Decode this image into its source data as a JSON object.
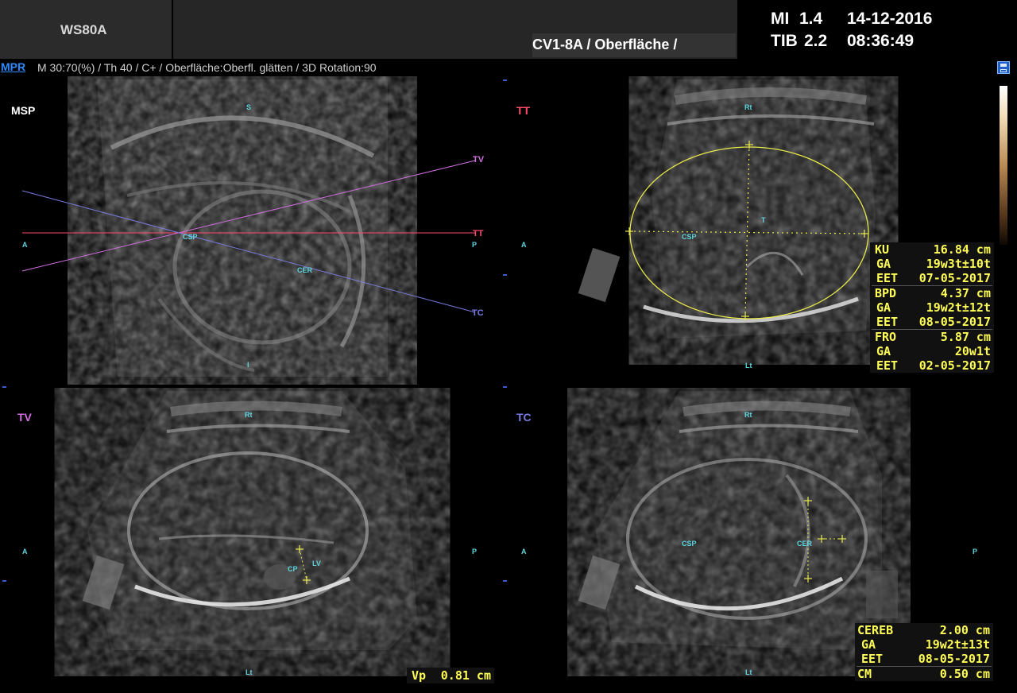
{
  "header": {
    "model": "WS80A",
    "probe_preset": "CV1-8A / Oberfläche /",
    "mi_label": "MI",
    "mi_value": "1.4",
    "tib_label": "TIB",
    "tib_value": "2.2",
    "date": "14-12-2016",
    "time": "08:36:49"
  },
  "infobar": {
    "mode": "MPR",
    "params": "M 30:70(%) / Th 40 / C+ / Oberfläche:Oberfl. glätten / 3D Rotation:90"
  },
  "colors": {
    "accent_blue": "#2e8bff",
    "plane_tv": "#d06ee0",
    "plane_tt": "#ff4a6a",
    "plane_tc": "#7a7ae0",
    "orientation_cyan": "#5fd7e0",
    "measurement_yellow": "#ffff55",
    "ellipse_yellow": "#e8e84a"
  },
  "planes": {
    "msp": {
      "label": "MSP",
      "orient": {
        "top": "S",
        "bottom": "I",
        "left": "A",
        "right": "P"
      },
      "structures": [
        "CSP",
        "CER"
      ],
      "lines": {
        "tv": "TV",
        "tt": "TT",
        "tc": "TC"
      }
    },
    "tt": {
      "label": "TT",
      "orient": {
        "top": "Rt",
        "bottom": "Lt",
        "left": "A",
        "right": "P"
      },
      "structures": [
        "CSP",
        "T"
      ]
    },
    "tv": {
      "label": "TV",
      "orient": {
        "top": "Rt",
        "bottom": "Lt",
        "left": "A",
        "right": "P"
      },
      "structures": [
        "CP",
        "LV"
      ]
    },
    "tc": {
      "label": "TC",
      "orient": {
        "top": "Rt",
        "bottom": "Lt",
        "left": "A",
        "right": "P"
      },
      "structures": [
        "CSP",
        "CER"
      ]
    }
  },
  "measurements_tt": [
    {
      "label": "KU",
      "value": "16.84 cm"
    },
    {
      "label": "GA",
      "value": "19w3t±10t"
    },
    {
      "label": "EET",
      "value": "07-05-2017"
    },
    {
      "label": "BPD",
      "value": "4.37 cm"
    },
    {
      "label": "GA",
      "value": "19w2t±12t"
    },
    {
      "label": "EET",
      "value": "08-05-2017"
    },
    {
      "label": "FRO",
      "value": "5.87 cm"
    },
    {
      "label": "GA",
      "value": "20w1t"
    },
    {
      "label": "EET",
      "value": "02-05-2017"
    }
  ],
  "measurement_tv": {
    "label": "Vp",
    "value": "0.81 cm"
  },
  "measurements_tc": [
    {
      "label": "CEREB",
      "value": "2.00 cm"
    },
    {
      "label": "GA",
      "value": "19w2t±13t"
    },
    {
      "label": "EET",
      "value": "08-05-2017"
    },
    {
      "label": "CM",
      "value": "0.50 cm"
    }
  ]
}
